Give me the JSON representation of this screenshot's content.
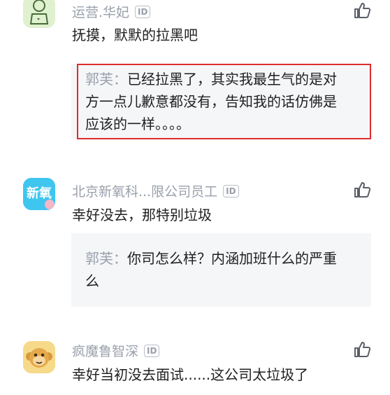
{
  "comments": [
    {
      "username": "运营.华妃",
      "id_badge": "ID",
      "text": "抚摸，默默的拉黑吧",
      "reply": {
        "author": "郭芙：",
        "line1": "已经拉黑了，其实我最生气的是对",
        "line2": "方一点儿歉意都没有，告知我的话仿佛是",
        "line3": "应该的一样。。。。"
      },
      "avatar_icon": "profile-avatar-icon",
      "like_icon": "thumbs-up-icon"
    },
    {
      "username": "北京新氧科...限公司员工",
      "id_badge": "ID",
      "text": "幸好没去，那特别垃圾",
      "avatar_text": "新氧",
      "reply": {
        "author": "郭芙：",
        "line1": "你司怎么样？内涵加班什么的严重",
        "line2": "么"
      },
      "like_icon": "thumbs-up-icon"
    },
    {
      "username": "疯魔鲁智深",
      "id_badge": "ID",
      "text": "幸好当初没去面试......这公司太垃圾了",
      "avatar_icon": "monkey-avatar-icon",
      "like_icon": "thumbs-up-icon"
    }
  ],
  "colors": {
    "highlight_border": "#e02b2b",
    "reply_bg": "#f5f6f8",
    "meta_gray": "#9aa0ab",
    "avatar2_bg": "#3ec6ef"
  }
}
